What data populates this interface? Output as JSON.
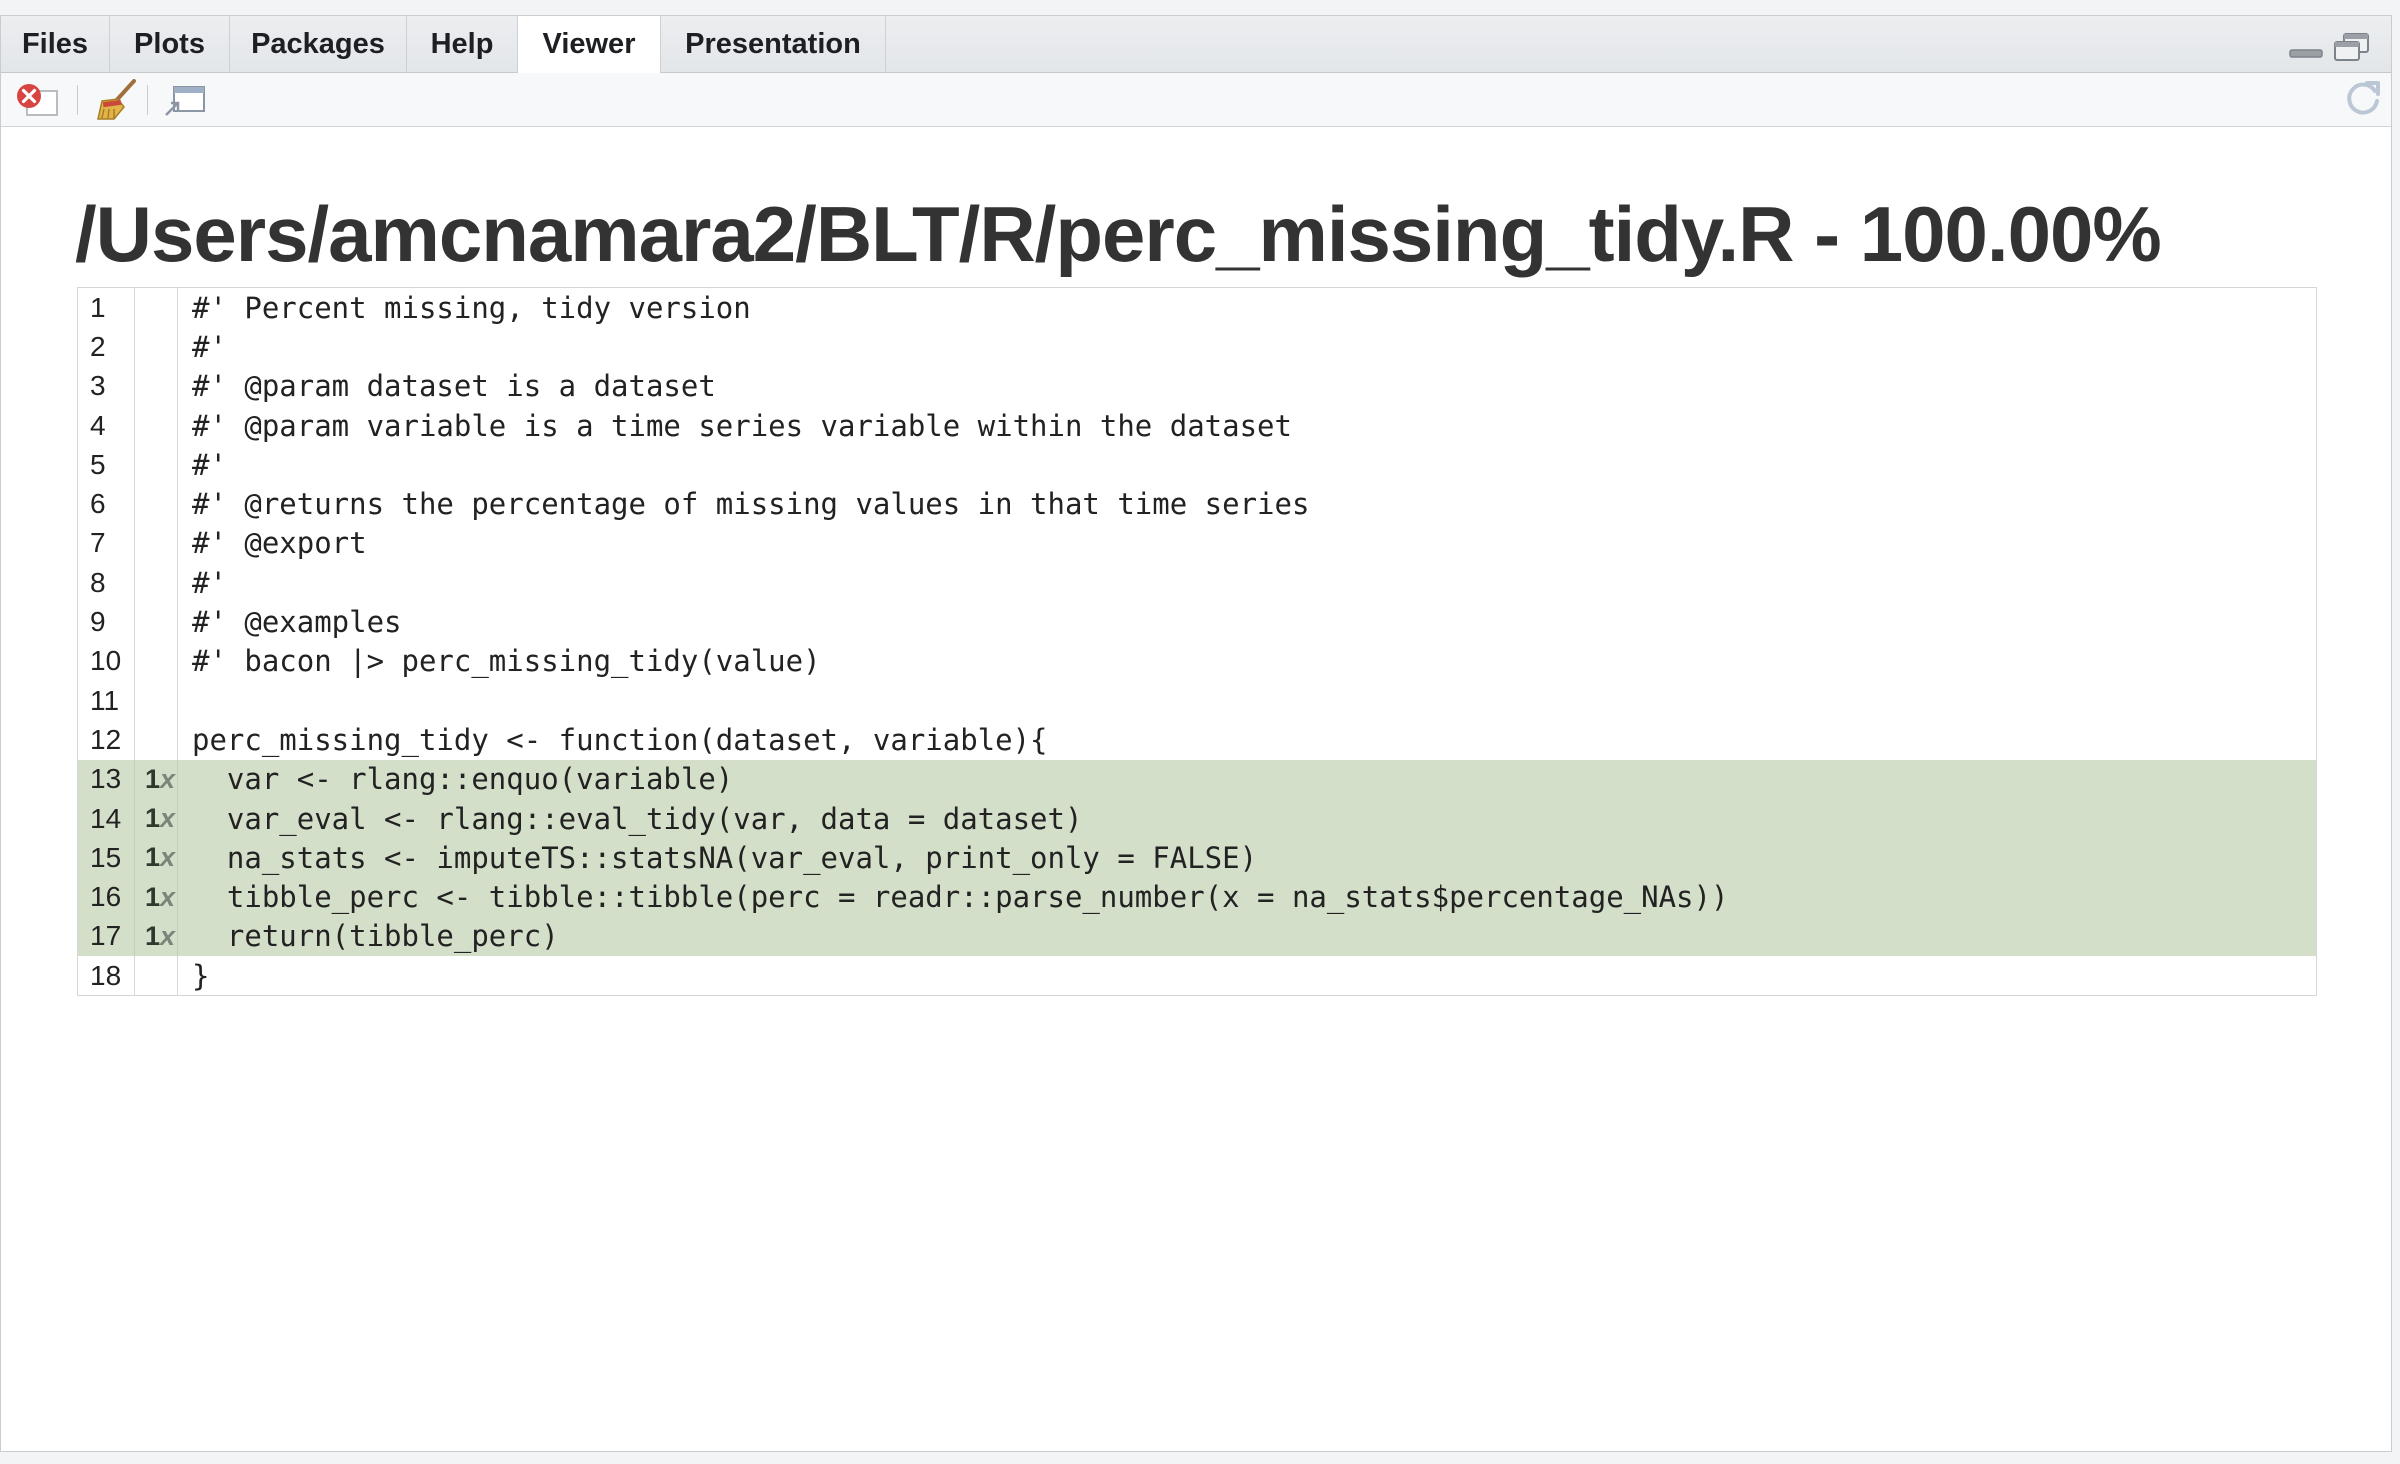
{
  "tabs": [
    {
      "label": "Files",
      "active": false
    },
    {
      "label": "Plots",
      "active": false
    },
    {
      "label": "Packages",
      "active": false
    },
    {
      "label": "Help",
      "active": false
    },
    {
      "label": "Viewer",
      "active": true
    },
    {
      "label": "Presentation",
      "active": false
    }
  ],
  "toolbar": {
    "icons": [
      "remove-viewer-icon",
      "clear-all-broom-icon",
      "show-in-new-window-icon",
      "refresh-icon"
    ]
  },
  "page": {
    "title": "/Users/amcnamara2/BLT/R/perc_missing_tidy.R - 100.00%"
  },
  "code": {
    "lines": [
      {
        "num": "1",
        "hits": "",
        "text": "#' Percent missing, tidy version",
        "covered": false
      },
      {
        "num": "2",
        "hits": "",
        "text": "#'",
        "covered": false
      },
      {
        "num": "3",
        "hits": "",
        "text": "#' @param dataset is a dataset",
        "covered": false
      },
      {
        "num": "4",
        "hits": "",
        "text": "#' @param variable is a time series variable within the dataset",
        "covered": false
      },
      {
        "num": "5",
        "hits": "",
        "text": "#'",
        "covered": false
      },
      {
        "num": "6",
        "hits": "",
        "text": "#' @returns the percentage of missing values in that time series",
        "covered": false
      },
      {
        "num": "7",
        "hits": "",
        "text": "#' @export",
        "covered": false
      },
      {
        "num": "8",
        "hits": "",
        "text": "#'",
        "covered": false
      },
      {
        "num": "9",
        "hits": "",
        "text": "#' @examples",
        "covered": false
      },
      {
        "num": "10",
        "hits": "",
        "text": "#' bacon |> perc_missing_tidy(value)",
        "covered": false
      },
      {
        "num": "11",
        "hits": "",
        "text": "",
        "covered": false
      },
      {
        "num": "12",
        "hits": "",
        "text": "perc_missing_tidy <- function(dataset, variable){",
        "covered": false
      },
      {
        "num": "13",
        "hits": "1",
        "text": "  var <- rlang::enquo(variable)",
        "covered": true
      },
      {
        "num": "14",
        "hits": "1",
        "text": "  var_eval <- rlang::eval_tidy(var, data = dataset)",
        "covered": true
      },
      {
        "num": "15",
        "hits": "1",
        "text": "  na_stats <- imputeTS::statsNA(var_eval, print_only = FALSE)",
        "covered": true
      },
      {
        "num": "16",
        "hits": "1",
        "text": "  tibble_perc <- tibble::tibble(perc = readr::parse_number(x = na_stats$percentage_NAs))",
        "covered": true
      },
      {
        "num": "17",
        "hits": "1",
        "text": "  return(tibble_perc)",
        "covered": true
      },
      {
        "num": "18",
        "hits": "",
        "text": "}",
        "covered": false
      }
    ],
    "hit_suffix": "x"
  },
  "colors": {
    "covered_bg": "#d4dfca",
    "title_text": "#333333",
    "close_red": "#d64541"
  }
}
